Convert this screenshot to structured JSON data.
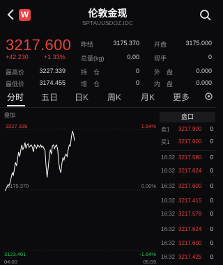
{
  "header": {
    "logo_text": "W",
    "title": "伦敦金现",
    "subtitle": "SPTAUUSDOZ.IDC"
  },
  "quote": {
    "price": "3217.600",
    "change": "+42.230",
    "change_pct": "+1.33%",
    "stats": [
      {
        "label": "昨结",
        "value": "3175.370"
      },
      {
        "label": "开盘",
        "value": "3175.000"
      },
      {
        "label": "总量(kg)",
        "value": "0.00"
      },
      {
        "label": "现手",
        "value": "0"
      },
      {
        "label": "最高价",
        "value": "3227.339"
      },
      {
        "label": "持　仓",
        "value": "0"
      },
      {
        "label": "外　盘",
        "value": "0.000"
      },
      {
        "label": "最低价",
        "value": "3174.455"
      },
      {
        "label": "增　仓",
        "value": "0"
      },
      {
        "label": "内　盘",
        "value": "0.000"
      }
    ]
  },
  "tabs": [
    {
      "label": "分时",
      "active": true
    },
    {
      "label": "五日"
    },
    {
      "label": "日K"
    },
    {
      "label": "周K"
    },
    {
      "label": "月K"
    },
    {
      "label": "更多"
    }
  ],
  "chart_data": {
    "type": "line",
    "legend": "叠加",
    "y_labels_left": {
      "top": "3227.339",
      "mid": "3175.370",
      "bottom": "3123.401"
    },
    "y_labels_right": {
      "top": "1.64%",
      "mid": "0.00%",
      "bottom": "-1.64%"
    },
    "ylim": [
      3123.401,
      3227.339
    ],
    "x_labels": [
      "04:00",
      "05:59"
    ],
    "series": [
      {
        "values": [
          3174.6,
          3176,
          3178,
          3180,
          3179,
          3182,
          3186,
          3190,
          3188,
          3193,
          3199,
          3196,
          3202,
          3208,
          3204,
          3209,
          3214,
          3210,
          3212,
          3216,
          3211,
          3214,
          3215,
          3212,
          3213,
          3214,
          3212,
          3208,
          3214,
          3213,
          3211,
          3214,
          3213,
          3212,
          3214,
          3212,
          3213,
          3211,
          3209,
          3196,
          3186,
          3194,
          3203,
          3210,
          3206,
          3213,
          3214,
          3211,
          3213,
          3214,
          3210,
          3199,
          3193,
          3190,
          3198,
          3203,
          3201,
          3205,
          3206,
          3204,
          3210,
          3214,
          3213,
          3221,
          3226,
          3223,
          3217.6
        ]
      }
    ]
  },
  "trade_panel": {
    "header": "盘口",
    "ask": {
      "label": "卖1",
      "price": "3217.900",
      "qty": "0"
    },
    "bid": {
      "label": "买1",
      "price": "3217.600",
      "qty": "0"
    },
    "trades": [
      {
        "time": "16:32",
        "price": "3217.580",
        "qty": "0"
      },
      {
        "time": "16:32",
        "price": "3217.624",
        "qty": "0"
      },
      {
        "time": "16:32",
        "price": "3217.600",
        "qty": "0"
      },
      {
        "time": "16:32",
        "price": "3217.415",
        "qty": "0"
      },
      {
        "time": "16:32",
        "price": "3217.578",
        "qty": "0"
      },
      {
        "time": "16:32",
        "price": "3217.624",
        "qty": "0"
      },
      {
        "time": "16:32",
        "price": "3217.600",
        "qty": "0"
      },
      {
        "time": "16:32",
        "price": "3217.425",
        "qty": "0"
      }
    ]
  },
  "colors": {
    "up": "#e8413f",
    "down": "#2fbf57",
    "bg": "#0b0b0d",
    "line": "#ffffff"
  }
}
